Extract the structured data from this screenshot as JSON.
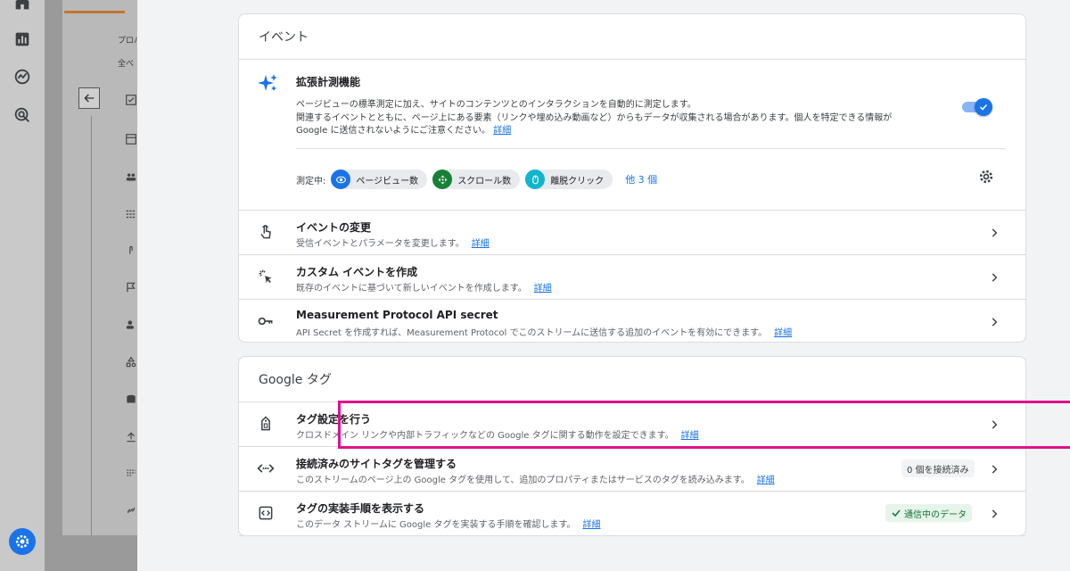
{
  "bg": {
    "prop_label": "プロパ",
    "all_label": "全べ"
  },
  "events": {
    "header": "イベント",
    "enhanced": {
      "title": "拡張計測機能",
      "desc_line1": "ページビューの標準測定に加え、サイトのコンテンツとのインタラクションを自動的に測定します。",
      "desc_line2": "関連するイベントとともに、ページ上にある要素（リンクや埋め込み動画など）からもデータが収集される場合があります。個人を特定できる情報が",
      "desc_line3": "Google に送信されないようにご注意ください。",
      "link": "詳細",
      "toggle_on": true,
      "measuring_label": "測定中:",
      "chips": [
        "ページビュー数",
        "スクロール数",
        "離脱クリック"
      ],
      "more": "他 3 個"
    },
    "rows": [
      {
        "title": "イベントの変更",
        "desc": "受信イベントとパラメータを変更します。",
        "link": "詳細"
      },
      {
        "title": "カスタム イベントを作成",
        "desc": "既存のイベントに基づいて新しいイベントを作成します。",
        "link": "詳細"
      },
      {
        "title": "Measurement Protocol API secret",
        "desc": "API Secret を作成すれば、Measurement Protocol でこのストリームに送信する追加のイベントを有効にできます。",
        "link": "詳細"
      }
    ]
  },
  "gtag": {
    "header": "Google タグ",
    "rows": [
      {
        "title": "タグ設定を行う",
        "desc": "クロスドメイン リンクや内部トラフィックなどの Google タグに関する動作を設定できます。",
        "link": "詳細"
      },
      {
        "title": "接続済みのサイトタグを管理する",
        "desc": "このストリームのページ上の Google タグを使用して、追加のプロパティまたはサービスのタグを読み込みます。",
        "link": "詳細",
        "badge": "0 個を接続済み"
      },
      {
        "title": "タグの実装手順を表示する",
        "desc": "このデータ ストリームに Google タグを実装する手順を確認します。",
        "link": "詳細",
        "badge": "通信中のデータ"
      }
    ]
  },
  "colors": {
    "accent": "#1a73e8",
    "highlight": "#e0118c",
    "green": "#137333"
  }
}
